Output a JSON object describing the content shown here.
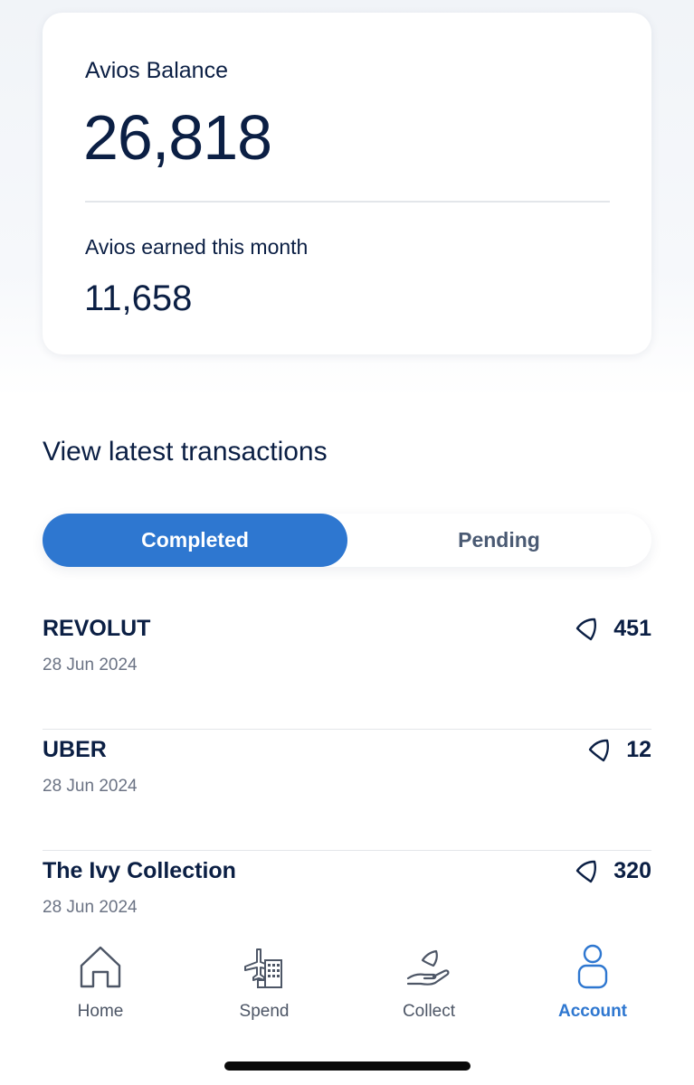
{
  "balance_card": {
    "balance_label": "Avios Balance",
    "balance_value": "26,818",
    "earned_label": "Avios earned this month",
    "earned_value": "11,658"
  },
  "transactions_section": {
    "title": "View latest transactions",
    "tabs": [
      {
        "label": "Completed",
        "active": true
      },
      {
        "label": "Pending",
        "active": false
      }
    ],
    "items": [
      {
        "merchant": "REVOLUT",
        "date": "28 Jun 2024",
        "avios": "451"
      },
      {
        "merchant": "UBER",
        "date": "28 Jun 2024",
        "avios": "12"
      },
      {
        "merchant": "The Ivy Collection",
        "date": "28 Jun 2024",
        "avios": "320"
      }
    ],
    "amount_icon": "avios-icon"
  },
  "bottom_nav": {
    "items": [
      {
        "label": "Home",
        "icon": "home-icon",
        "active": false
      },
      {
        "label": "Spend",
        "icon": "plane-building-icon",
        "active": false
      },
      {
        "label": "Collect",
        "icon": "hand-avios-icon",
        "active": false
      },
      {
        "label": "Account",
        "icon": "person-icon",
        "active": true
      }
    ]
  },
  "colors": {
    "accent": "#2e77d0",
    "text_primary": "#0b1f44",
    "text_secondary": "#6b7384"
  }
}
